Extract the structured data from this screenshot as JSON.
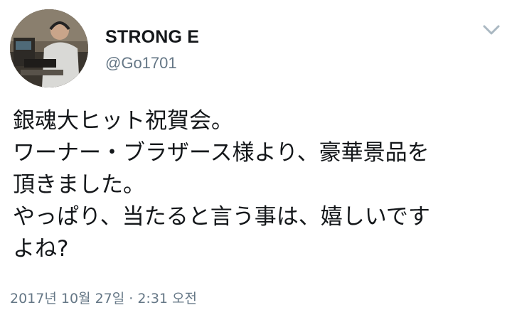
{
  "author": {
    "name": "STRONG E",
    "handle": "@Go1701"
  },
  "tweet": {
    "lines": [
      "銀魂大ヒット祝賀会。",
      "ワーナー・ブラザース様より、豪華景品を",
      "頂きました。",
      "やっぱり、当たると言う事は、嬉しいです",
      "よね?"
    ],
    "timestamp": "2017년 10월 27일 · 2:31 오전"
  },
  "icons": {
    "menu": "chevron-down-icon",
    "avatar": "profile-photo"
  },
  "colors": {
    "text": "#14171a",
    "secondary": "#657786",
    "chevron": "#aab8c2"
  }
}
